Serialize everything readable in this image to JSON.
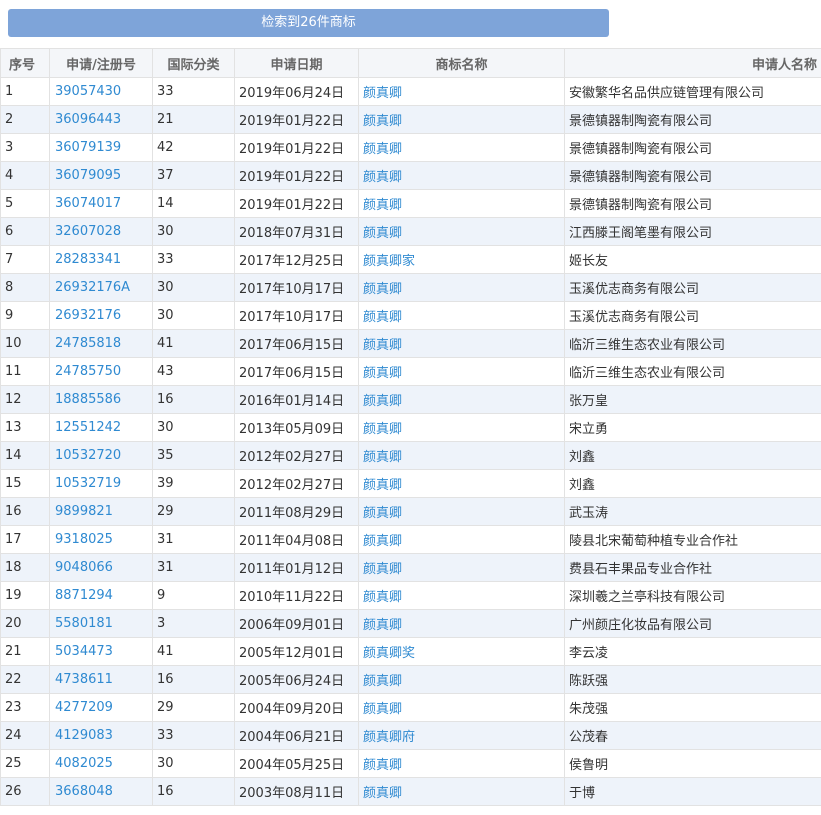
{
  "banner": {
    "label": "检索到26件商标"
  },
  "table": {
    "headers": [
      "序号",
      "申请/注册号",
      "国际分类",
      "申请日期",
      "商标名称",
      "申请人名称"
    ],
    "rows": [
      {
        "idx": "1",
        "reg": "39057430",
        "cls": "33",
        "date": "2019年06月24日",
        "name": "颜真卿",
        "applicant": "安徽繁华名品供应链管理有限公司"
      },
      {
        "idx": "2",
        "reg": "36096443",
        "cls": "21",
        "date": "2019年01月22日",
        "name": "颜真卿",
        "applicant": "景德镇器制陶瓷有限公司"
      },
      {
        "idx": "3",
        "reg": "36079139",
        "cls": "42",
        "date": "2019年01月22日",
        "name": "颜真卿",
        "applicant": "景德镇器制陶瓷有限公司"
      },
      {
        "idx": "4",
        "reg": "36079095",
        "cls": "37",
        "date": "2019年01月22日",
        "name": "颜真卿",
        "applicant": "景德镇器制陶瓷有限公司"
      },
      {
        "idx": "5",
        "reg": "36074017",
        "cls": "14",
        "date": "2019年01月22日",
        "name": "颜真卿",
        "applicant": "景德镇器制陶瓷有限公司"
      },
      {
        "idx": "6",
        "reg": "32607028",
        "cls": "30",
        "date": "2018年07月31日",
        "name": "颜真卿",
        "applicant": "江西滕王阁笔墨有限公司"
      },
      {
        "idx": "7",
        "reg": "28283341",
        "cls": "33",
        "date": "2017年12月25日",
        "name": "颜真卿家",
        "applicant": "姬长友"
      },
      {
        "idx": "8",
        "reg": "26932176A",
        "cls": "30",
        "date": "2017年10月17日",
        "name": "颜真卿",
        "applicant": "玉溪优志商务有限公司"
      },
      {
        "idx": "9",
        "reg": "26932176",
        "cls": "30",
        "date": "2017年10月17日",
        "name": "颜真卿",
        "applicant": "玉溪优志商务有限公司"
      },
      {
        "idx": "10",
        "reg": "24785818",
        "cls": "41",
        "date": "2017年06月15日",
        "name": "颜真卿",
        "applicant": "临沂三维生态农业有限公司"
      },
      {
        "idx": "11",
        "reg": "24785750",
        "cls": "43",
        "date": "2017年06月15日",
        "name": "颜真卿",
        "applicant": "临沂三维生态农业有限公司"
      },
      {
        "idx": "12",
        "reg": "18885586",
        "cls": "16",
        "date": "2016年01月14日",
        "name": "颜真卿",
        "applicant": "张万皇"
      },
      {
        "idx": "13",
        "reg": "12551242",
        "cls": "30",
        "date": "2013年05月09日",
        "name": "颜真卿",
        "applicant": "宋立勇"
      },
      {
        "idx": "14",
        "reg": "10532720",
        "cls": "35",
        "date": "2012年02月27日",
        "name": "颜真卿",
        "applicant": "刘鑫"
      },
      {
        "idx": "15",
        "reg": "10532719",
        "cls": "39",
        "date": "2012年02月27日",
        "name": "颜真卿",
        "applicant": "刘鑫"
      },
      {
        "idx": "16",
        "reg": "9899821",
        "cls": "29",
        "date": "2011年08月29日",
        "name": "颜真卿",
        "applicant": "武玉涛"
      },
      {
        "idx": "17",
        "reg": "9318025",
        "cls": "31",
        "date": "2011年04月08日",
        "name": "颜真卿",
        "applicant": "陵县北宋葡萄种植专业合作社"
      },
      {
        "idx": "18",
        "reg": "9048066",
        "cls": "31",
        "date": "2011年01月12日",
        "name": "颜真卿",
        "applicant": "费县石丰果品专业合作社"
      },
      {
        "idx": "19",
        "reg": "8871294",
        "cls": "9",
        "date": "2010年11月22日",
        "name": "颜真卿",
        "applicant": "深圳羲之兰亭科技有限公司"
      },
      {
        "idx": "20",
        "reg": "5580181",
        "cls": "3",
        "date": "2006年09月01日",
        "name": "颜真卿",
        "applicant": "广州颜庄化妆品有限公司"
      },
      {
        "idx": "21",
        "reg": "5034473",
        "cls": "41",
        "date": "2005年12月01日",
        "name": "颜真卿奖",
        "applicant": "李云凌"
      },
      {
        "idx": "22",
        "reg": "4738611",
        "cls": "16",
        "date": "2005年06月24日",
        "name": "颜真卿",
        "applicant": "陈跃强"
      },
      {
        "idx": "23",
        "reg": "4277209",
        "cls": "29",
        "date": "2004年09月20日",
        "name": "颜真卿",
        "applicant": "朱茂强"
      },
      {
        "idx": "24",
        "reg": "4129083",
        "cls": "33",
        "date": "2004年06月21日",
        "name": "颜真卿府",
        "applicant": "公茂春"
      },
      {
        "idx": "25",
        "reg": "4082025",
        "cls": "30",
        "date": "2004年05月25日",
        "name": "颜真卿",
        "applicant": "侯鲁明"
      },
      {
        "idx": "26",
        "reg": "3668048",
        "cls": "16",
        "date": "2003年08月11日",
        "name": "颜真卿",
        "applicant": "于博"
      }
    ]
  }
}
